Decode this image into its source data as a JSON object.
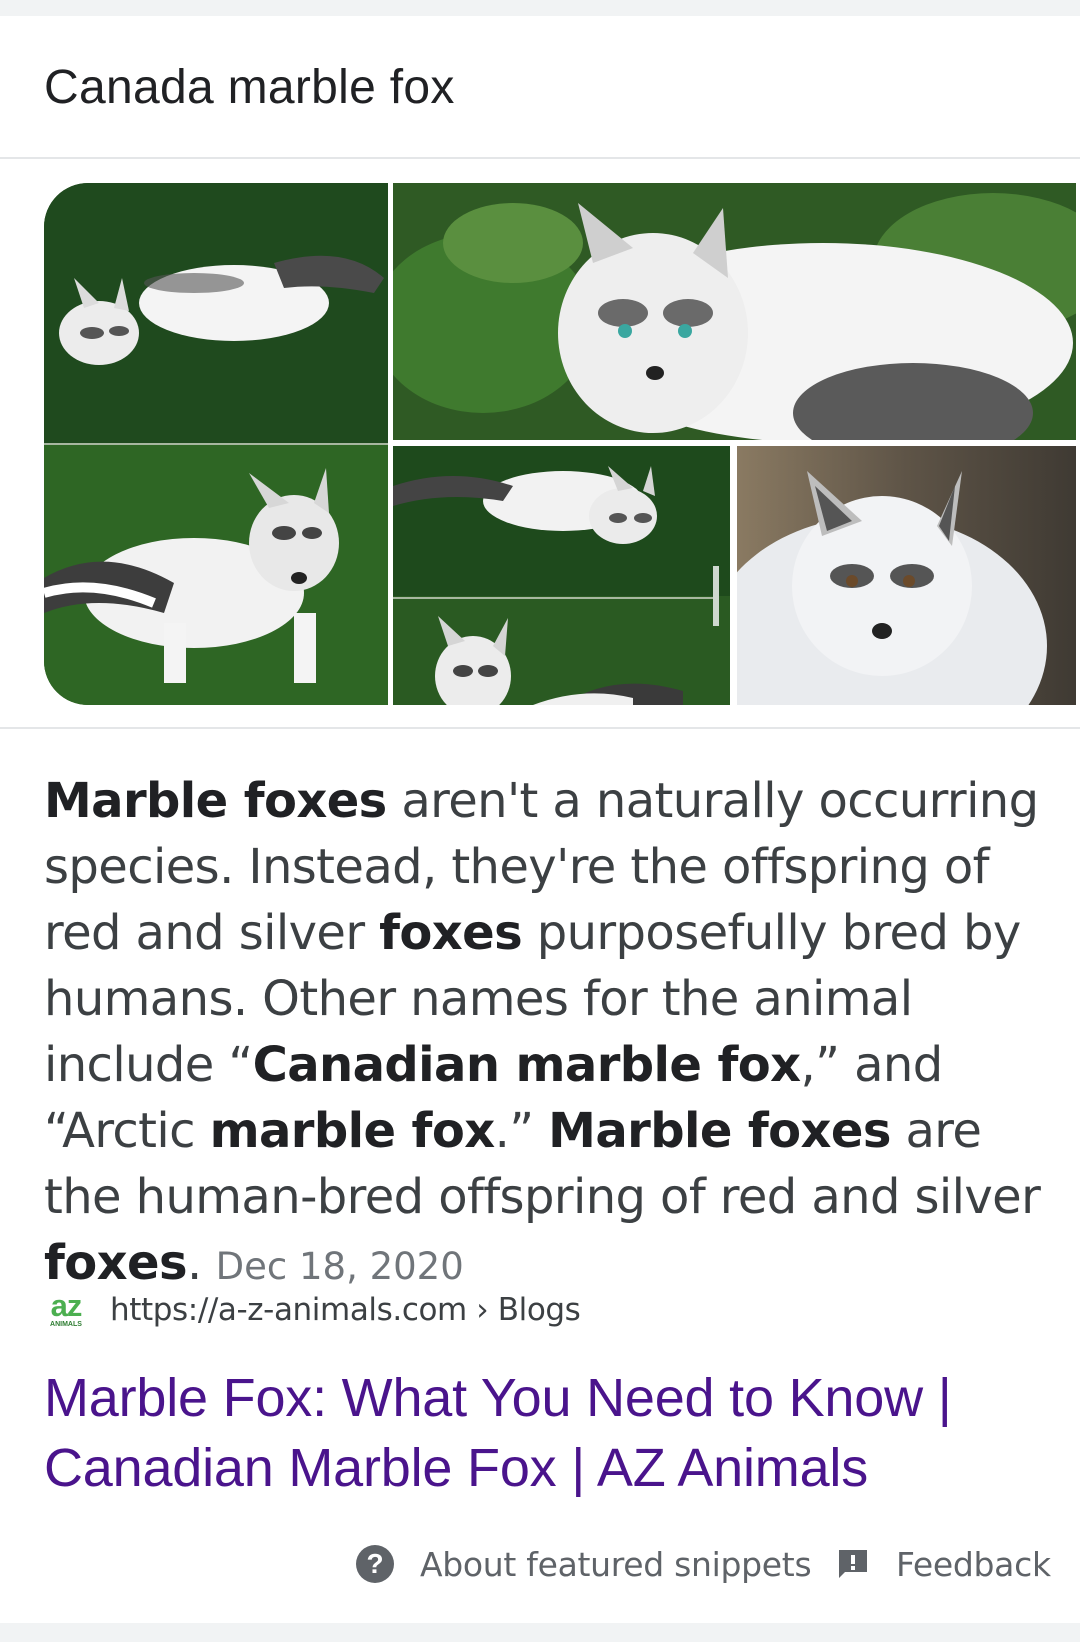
{
  "header": {
    "title": "Canada marble fox"
  },
  "images": [
    {
      "name": "fox-grass-collage-left"
    },
    {
      "name": "fox-grass-closeup"
    },
    {
      "name": "fox-grass-collage-small"
    },
    {
      "name": "fox-white-portrait"
    }
  ],
  "snippet": {
    "segments": [
      {
        "text": "Marble foxes",
        "bold": true
      },
      {
        "text": " aren't a naturally occurring species. Instead, they're the offspring of red and silver ",
        "bold": false
      },
      {
        "text": "foxes",
        "bold": true
      },
      {
        "text": " purposefully bred by humans. Other names for the animal include “",
        "bold": false
      },
      {
        "text": "Canadian marble fox",
        "bold": true
      },
      {
        "text": ",” and “Arctic ",
        "bold": false
      },
      {
        "text": "marble fox",
        "bold": true
      },
      {
        "text": ".” ",
        "bold": false
      },
      {
        "text": "Marble foxes",
        "bold": true
      },
      {
        "text": " are the human-bred offspring of red and silver ",
        "bold": false
      },
      {
        "text": "foxes",
        "bold": true
      },
      {
        "text": ".",
        "bold": false
      }
    ],
    "date": "Dec 18, 2020"
  },
  "source": {
    "favicon_text": "az",
    "favicon_subtext": "ANIMALS",
    "url": "https://a-z-animals.com › Blogs"
  },
  "result": {
    "title": "Marble Fox: What You Need to Know | Canadian Marble Fox | AZ Animals"
  },
  "footer": {
    "about_label": "About featured snippets",
    "feedback_label": "Feedback"
  },
  "colors": {
    "link": "#4a148c",
    "text": "#3c4043",
    "muted": "#70757a",
    "favicon": "#4caf50"
  }
}
